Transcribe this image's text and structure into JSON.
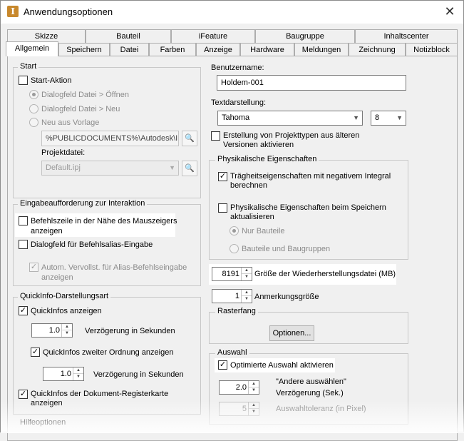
{
  "window": {
    "title": "Anwendungsoptionen"
  },
  "tabs_row1": [
    "Skizze",
    "Bauteil",
    "iFeature",
    "Baugruppe",
    "Inhaltscenter"
  ],
  "tabs_row2": [
    "Allgemein",
    "Speichern",
    "Datei",
    "Farben",
    "Anzeige",
    "Hardware",
    "Meldungen",
    "Zeichnung",
    "Notizblock"
  ],
  "start": {
    "group_label": "Start",
    "start_action": "Start-Aktion",
    "radio_open": "Dialogfeld Datei > Öffnen",
    "radio_new": "Dialogfeld Datei > Neu",
    "radio_template": "Neu aus Vorlage",
    "template_path": "%PUBLICDOCUMENTS%\\Autodesk\\Inv",
    "project_label": "Projektdatei:",
    "project_value": "Default.ipj"
  },
  "prompt": {
    "group_label": "Eingabeaufforderung zur Interaktion",
    "cmdline_line1": "Befehlszeile in der Nähe des Mauszeigers",
    "cmdline_line2": "anzeigen",
    "alias_dialog": "Dialogfeld für Befehlsalias-Eingabe",
    "autocomplete_line1": "Autom. Vervollst. für Alias-Befehlseingabe",
    "autocomplete_line2": "anzeigen"
  },
  "quickinfo": {
    "group_label": "QuickInfo-Darstellungsart",
    "show": "QuickInfos anzeigen",
    "delay1_value": "1.0",
    "delay_label": "Verzögerung in Sekunden",
    "second_order": "QuickInfos zweiter Ordnung anzeigen",
    "delay2_value": "1.0",
    "doc_tab_line1": "QuickInfos der Dokument-Registerkarte",
    "doc_tab_line2": "anzeigen"
  },
  "help_options": "Hilfeoptionen",
  "user": {
    "label": "Benutzername:",
    "value": "Holdem-001"
  },
  "text": {
    "label": "Textdarstellung:",
    "font": "Tahoma",
    "size": "8"
  },
  "project_types_line1": "Erstellung von Projekttypen aus älteren",
  "project_types_line2": "Versionen aktivieren",
  "physical": {
    "group_label": "Physikalische Eigenschaften",
    "inertia_line1": "Trägheitseigenschaften mit negativem Integral",
    "inertia_line2": "berechnen",
    "update_line1": "Physikalische Eigenschaften beim Speichern",
    "update_line2": "aktualisieren",
    "radio_parts": "Nur Bauteile",
    "radio_parts_assemblies": "Bauteile und Baugruppen"
  },
  "recovery": {
    "value": "8191",
    "label": "Größe der Wiederherstellungsdatei (MB)"
  },
  "annotation": {
    "value": "1",
    "label": "Anmerkungsgröße"
  },
  "grid_snap": {
    "group_label": "Rasterfang",
    "options_button": "Optionen..."
  },
  "selection": {
    "group_label": "Auswahl",
    "optimized": "Optimierte Auswahl aktivieren",
    "delay_value": "2.0",
    "select_other_line1": "\"Andere auswählen\"",
    "select_other_line2": "Verzögerung (Sek.)",
    "tolerance_value": "5",
    "tolerance_label": "Auswahltoleranz (in Pixel)"
  },
  "glyphs": {
    "check": "✓",
    "close": "✕",
    "app": "I",
    "down": "▼",
    "up": "▲",
    "browse": "🔍"
  }
}
